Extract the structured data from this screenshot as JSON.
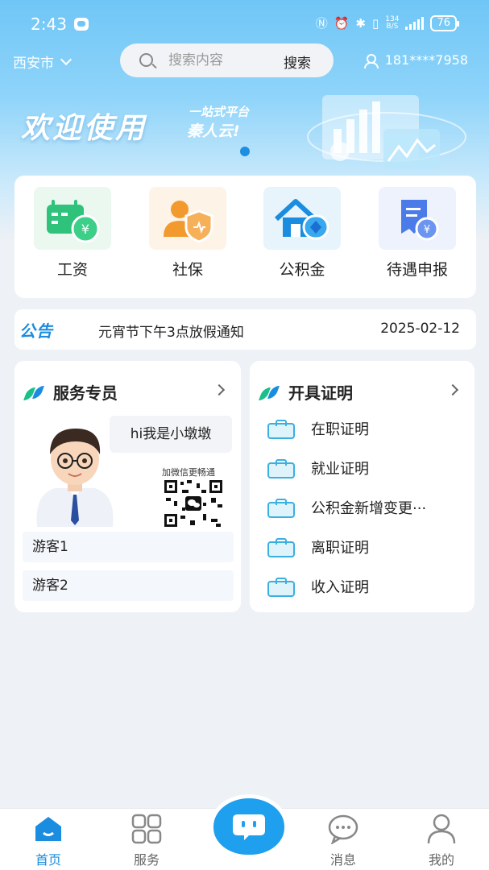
{
  "status_bar": {
    "time": "2:43",
    "network_speed_top": "134",
    "network_speed_bottom": "B/S",
    "battery": "76"
  },
  "topbar": {
    "city": "西安市",
    "search_placeholder": "搜索内容",
    "search_button": "搜索",
    "user_phone": "181****7958"
  },
  "banner": {
    "headline": "欢迎使用",
    "tagline_1": "一站式平台",
    "tagline_2": "秦人云!"
  },
  "quick_links": [
    {
      "label": "工资",
      "icon": "salary-calendar-icon",
      "color": "#2fc27a"
    },
    {
      "label": "社保",
      "icon": "social-security-shield-icon",
      "color": "#f29a2e"
    },
    {
      "label": "公积金",
      "icon": "housing-fund-house-icon",
      "color": "#1b8de0"
    },
    {
      "label": "待遇申报",
      "icon": "benefit-declaration-icon",
      "color": "#4a7be8"
    }
  ],
  "notice": {
    "tag": "公告",
    "title": "元宵节下午3点放假通知",
    "date": "2025-02-12"
  },
  "service_panel": {
    "title": "服务专员",
    "greeting": "hi我是小墩墩",
    "qr_caption": "加微信更畅通",
    "guests": [
      "游客1",
      "游客2"
    ]
  },
  "certificate_panel": {
    "title": "开具证明",
    "items": [
      "在职证明",
      "就业证明",
      "公积金新增变更···",
      "离职证明",
      "收入证明"
    ]
  },
  "bottom_nav": {
    "items": [
      {
        "label": "首页",
        "icon": "home-icon",
        "active": true
      },
      {
        "label": "服务",
        "icon": "grid-icon",
        "active": false
      },
      {
        "label": "消息",
        "icon": "chat-bubble-icon",
        "active": false
      },
      {
        "label": "我的",
        "icon": "person-icon",
        "active": false
      }
    ]
  },
  "colors": {
    "accent": "#1b8de0",
    "hero_top": "#6fc6f6",
    "background": "#eef1f6"
  }
}
